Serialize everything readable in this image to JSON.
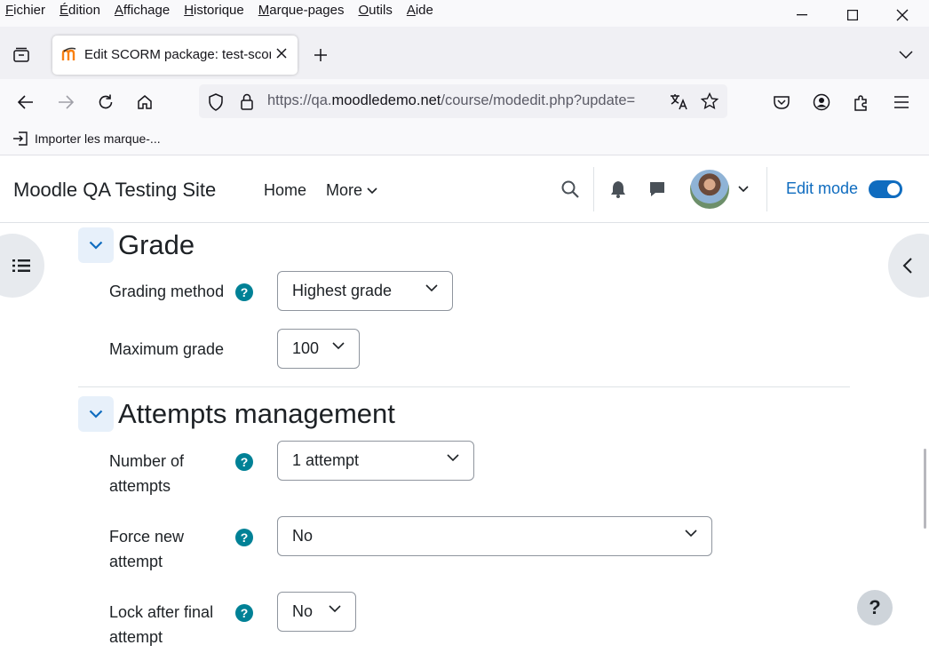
{
  "browser": {
    "menu": [
      "Fichier",
      "Édition",
      "Affichage",
      "Historique",
      "Marque-pages",
      "Outils",
      "Aide"
    ],
    "tab_title": "Edit SCORM package: test-scorm",
    "url_prefix": "https://qa.",
    "url_domain": "moodledemo.net",
    "url_path": "/course/modedit.php?update=",
    "bookmark_label": "Importer les marque-..."
  },
  "moodle": {
    "site_name": "Moodle QA Testing Site",
    "nav_home": "Home",
    "nav_more": "More",
    "edit_mode_label": "Edit mode",
    "edit_mode_on": true
  },
  "form": {
    "grade_section": {
      "title": "Grade",
      "grading_method_label": "Grading method",
      "grading_method_value": "Highest grade",
      "maximum_grade_label": "Maximum grade",
      "maximum_grade_value": "100"
    },
    "attempts_section": {
      "title": "Attempts management",
      "num_attempts_label": "Number of attempts",
      "num_attempts_value": "1 attempt",
      "force_new_label": "Force new attempt",
      "force_new_value": "No",
      "lock_after_label": "Lock after final attempt",
      "lock_after_value": "No"
    }
  },
  "help_button": "?",
  "colors": {
    "accent": "#0f6cbf",
    "help": "#008196"
  }
}
